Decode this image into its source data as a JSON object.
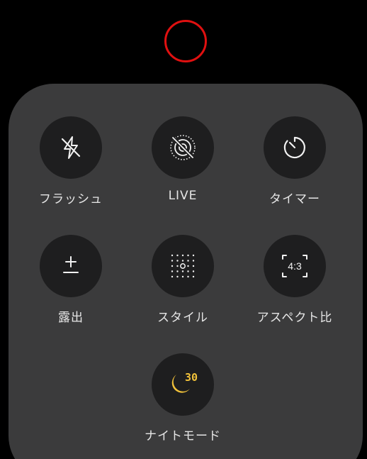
{
  "colors": {
    "page_background": "#000000",
    "panel_background": "#3b3b3c",
    "button_background": "#1e1e1f",
    "label_text": "#e6e6e6",
    "icon_stroke": "#f2f2f2",
    "night_mode_accent": "#f2c23a",
    "recording_indicator": "#e01010"
  },
  "status": {
    "indicator_icon": "red-ring-icon"
  },
  "controls": [
    {
      "id": "flash",
      "label": "フラッシュ",
      "icon": "flash-off-icon"
    },
    {
      "id": "live",
      "label": "LIVE",
      "icon": "live-photo-off-icon"
    },
    {
      "id": "timer",
      "label": "タイマー",
      "icon": "timer-icon"
    },
    {
      "id": "exposure",
      "label": "露出",
      "icon": "plus-minus-icon"
    },
    {
      "id": "styles",
      "label": "スタイル",
      "icon": "photographic-styles-grid-icon"
    },
    {
      "id": "aspect",
      "label": "アスペクト比",
      "icon": "aspect-ratio-icon",
      "icon_text": "4:3"
    },
    {
      "id": "night",
      "label": "ナイトモード",
      "icon": "moon-icon",
      "icon_text": "30"
    }
  ]
}
